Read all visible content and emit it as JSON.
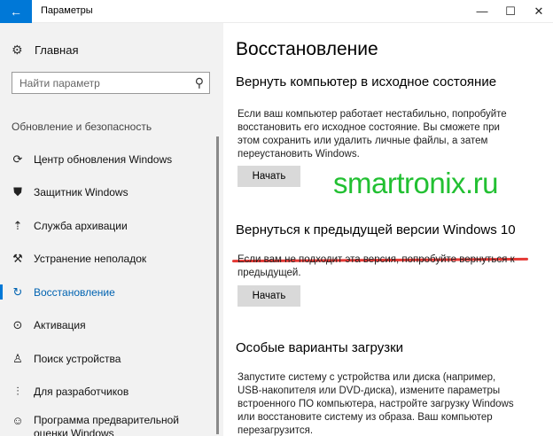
{
  "window": {
    "title": "Параметры",
    "back_icon": "back-arrow-icon",
    "minimize": "—",
    "maximize": "☐",
    "close": "✕"
  },
  "sidebar": {
    "home_label": "Главная",
    "search_placeholder": "Найти параметр",
    "section_title": "Обновление и безопасность",
    "items": [
      {
        "label": "Центр обновления Windows",
        "icon": "refresh-icon"
      },
      {
        "label": "Защитник Windows",
        "icon": "shield-icon"
      },
      {
        "label": "Служба архивации",
        "icon": "backup-arrow-icon"
      },
      {
        "label": "Устранение неполадок",
        "icon": "wrench-icon"
      },
      {
        "label": "Восстановление",
        "icon": "recovery-icon",
        "active": true
      },
      {
        "label": "Активация",
        "icon": "activation-check-icon"
      },
      {
        "label": "Поиск устройства",
        "icon": "person-locate-icon"
      },
      {
        "label": "Для разработчиков",
        "icon": "developer-sliders-icon"
      },
      {
        "label": "Программа предварительной оценки Windows",
        "icon": "insider-smiley-icon"
      }
    ]
  },
  "main": {
    "title": "Восстановление",
    "reset": {
      "heading": "Вернуть компьютер в исходное состояние",
      "description": "Если ваш компьютер работает нестабильно, попробуйте восстановить его исходное состояние. Вы сможете при этом сохранить или удалить личные файлы, а затем переустановить Windows.",
      "button": "Начать"
    },
    "rollback": {
      "heading": "Вернуться к предыдущей версии Windows 10",
      "description": "Если вам не подходит эта версия, попробуйте вернуться к предыдущей.",
      "button": "Начать"
    },
    "advanced": {
      "heading": "Особые варианты загрузки",
      "description": "Запустите систему с устройства или диска (например, USB-накопителя или DVD-диска), измените параметры встроенного ПО компьютера, настройте загрузку Windows или восстановите систему из образа. Ваш компьютер перезагрузится."
    }
  },
  "watermark": "smartronix.ru",
  "colors": {
    "accent": "#0078d7",
    "watermark": "#22c032",
    "highlight_underline": "#e53935"
  }
}
